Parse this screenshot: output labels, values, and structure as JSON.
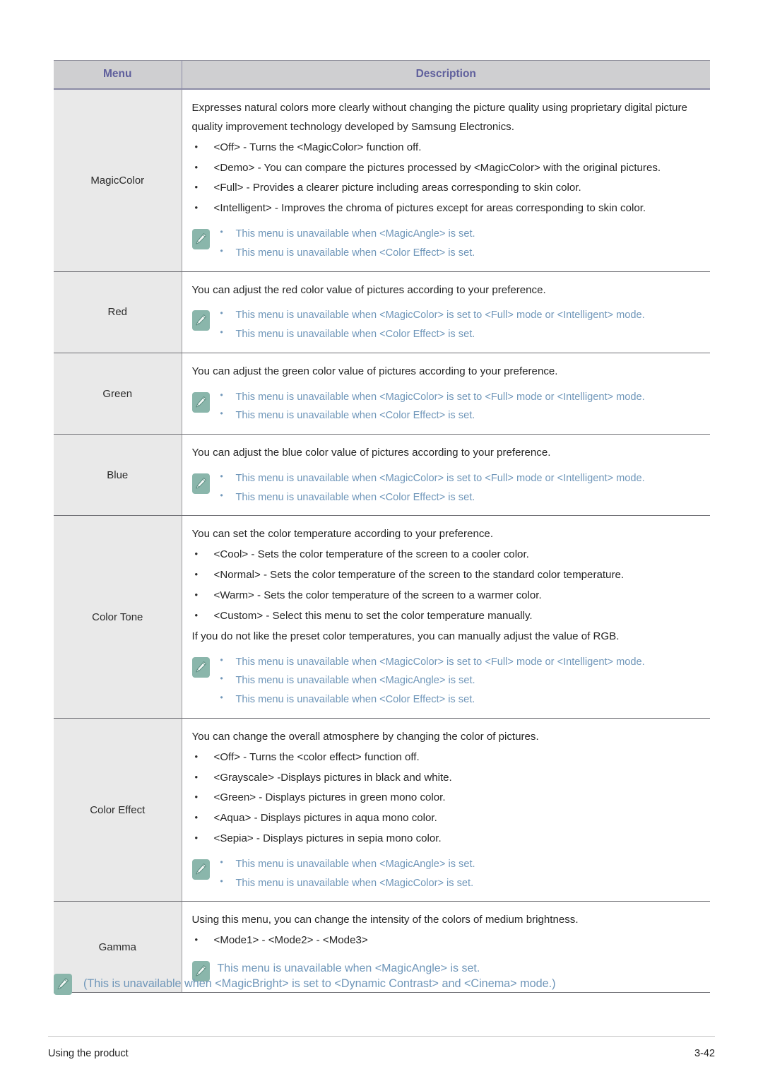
{
  "table": {
    "headers": {
      "menu": "Menu",
      "description": "Description"
    },
    "rows": [
      {
        "menu": "MagicColor",
        "paragraphs": [
          "Expresses natural colors more clearly without changing the picture quality using proprietary digital picture quality improvement technology developed by Samsung Electronics."
        ],
        "bullets": [
          "<Off> - Turns the <MagicColor> function off.",
          "<Demo> - You can compare the pictures processed by <MagicColor> with the original pictures.",
          "<Full> - Provides a clearer picture including areas corresponding to skin color.",
          "<Intelligent> - Improves the chroma of pictures except for areas corresponding to skin color."
        ],
        "notes": [
          "This menu is unavailable when <MagicAngle> is set.",
          "This menu is unavailable when <Color Effect> is set."
        ],
        "note_style": "bulleted"
      },
      {
        "menu": "Red",
        "paragraphs": [
          "You can adjust the red color value of pictures according to your preference."
        ],
        "bullets": [],
        "notes": [
          "This menu is unavailable when <MagicColor> is set to <Full> mode or <Intelligent> mode.",
          "This menu is unavailable when <Color Effect> is set."
        ],
        "note_style": "bulleted"
      },
      {
        "menu": "Green",
        "paragraphs": [
          "You can adjust the green color value of pictures according to your preference."
        ],
        "bullets": [],
        "notes": [
          "This menu is unavailable when <MagicColor> is set to <Full> mode or <Intelligent> mode.",
          "This menu is unavailable when <Color Effect> is set."
        ],
        "note_style": "bulleted"
      },
      {
        "menu": "Blue",
        "paragraphs": [
          "You can adjust the blue color value of pictures according to your preference."
        ],
        "bullets": [],
        "notes": [
          "This menu is unavailable when <MagicColor> is set to <Full> mode or <Intelligent> mode.",
          "This menu is unavailable when <Color Effect> is set."
        ],
        "note_style": "bulleted"
      },
      {
        "menu": "Color Tone",
        "paragraphs": [
          "You can set the color temperature according to your preference."
        ],
        "bullets": [
          "<Cool> - Sets the color temperature of the screen to a cooler color.",
          "<Normal> - Sets the color temperature of the screen to the standard color temperature.",
          "<Warm> - Sets the color temperature of the screen to a warmer color.",
          "<Custom> - Select this menu to set the color temperature manually."
        ],
        "trailing_paragraph": "If you do not like the preset color temperatures, you can manually adjust the value of RGB.",
        "notes": [
          "This menu is unavailable when <MagicColor> is set to <Full> mode or <Intelligent> mode.",
          "This menu is unavailable when <MagicAngle> is set.",
          "This menu is unavailable when <Color Effect> is set."
        ],
        "note_style": "bulleted"
      },
      {
        "menu": "Color Effect",
        "paragraphs": [
          "You can change the overall atmosphere by changing the color of pictures."
        ],
        "bullets": [
          "<Off> - Turns the <color effect> function off.",
          "<Grayscale> -Displays pictures in black and white.",
          "<Green> - Displays pictures in green mono color.",
          "<Aqua> - Displays pictures in aqua mono color.",
          "<Sepia> - Displays pictures in sepia mono color."
        ],
        "notes": [
          "This menu is unavailable when <MagicAngle> is set.",
          "This menu is unavailable when <MagicColor> is set."
        ],
        "note_style": "bulleted"
      },
      {
        "menu": "Gamma",
        "paragraphs": [
          "Using this menu, you can change the intensity of the colors of medium brightness."
        ],
        "bullets": [
          "<Mode1> - <Mode2> - <Mode3>"
        ],
        "notes": [
          "This menu is unavailable when <MagicAngle> is set."
        ],
        "note_style": "plain"
      }
    ]
  },
  "footer_note": {
    "text": "(This is unavailable when <MagicBright> is set to <Dynamic Contrast> and <Cinema> mode.)"
  },
  "page_footer": {
    "left": "Using the product",
    "right": "3-42"
  },
  "icons": {
    "note": "pencil-note-icon"
  },
  "colors": {
    "header_bg": "#cfcfd1",
    "header_text": "#5f5f9c",
    "menu_cell_bg": "#e9e9e9",
    "note_text": "#6f96b9",
    "note_icon_bg": "#8ab6ab",
    "body_text": "#262626"
  },
  "bullet_glyph": "•"
}
